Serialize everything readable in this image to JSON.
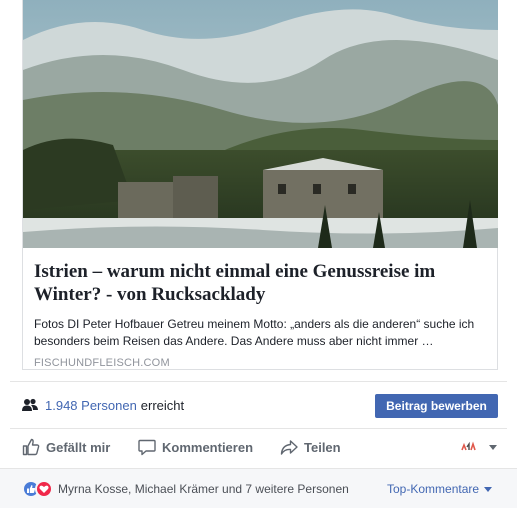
{
  "link_card": {
    "title": "Istrien – warum nicht einmal eine Genussreise im Winter? - von Rucksacklady",
    "excerpt": "Fotos DI Peter Hofbauer Getreu meinem Motto: „anders als die anderen“ suche ich besonders beim Reisen das Andere. Das Andere muss aber nicht immer …",
    "domain": "FISCHUNDFLEISCH.COM"
  },
  "reach": {
    "count": "1.948 Personen",
    "suffix": "erreicht",
    "icon": "people-icon"
  },
  "promote_button": "Beitrag bewerben",
  "actions": {
    "like": "Gefällt mir",
    "comment": "Kommentieren",
    "share": "Teilen"
  },
  "reactions": {
    "names": "Myrna Kosse, Michael Krämer und 7 weitere Personen",
    "sort": "Top-Kommentare"
  },
  "colors": {
    "brand_blue": "#4267b2",
    "like_blue": "#4a7cd7",
    "love_red": "#f0284a",
    "muted_text": "#606770"
  }
}
